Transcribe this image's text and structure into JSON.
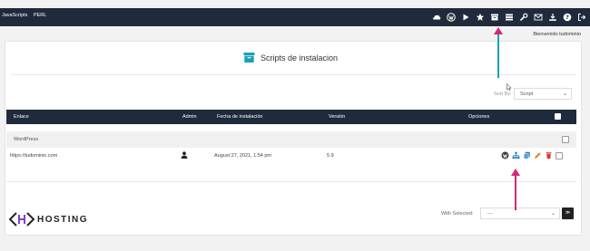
{
  "topbar": {
    "brand_items": [
      "JavaScripts",
      "PERL"
    ],
    "icons": [
      "cloudflare-icon",
      "wordpress-icon",
      "play-icon",
      "star-icon",
      "box-icon",
      "list-icon",
      "wrench-icon",
      "mail-icon",
      "download-icon",
      "help-icon",
      "logout-icon"
    ]
  },
  "welcome_text": "Bienvenido tudominio",
  "page": {
    "title": "Scripts de instalacion",
    "title_icon": "box-icon",
    "sort_label": "Sort By:",
    "sort_value": "Script"
  },
  "table": {
    "columns": [
      "Enlace",
      "Admin",
      "Fecha de instalación",
      "Versión",
      "Opciones"
    ],
    "groups": [
      {
        "name": "WordPress",
        "rows": [
          {
            "link": "https://tudominio.com",
            "admin_icon": "user-icon",
            "date": "August 27, 2021, 1:54 pm",
            "version": "5.9",
            "options": [
              "wordpress-icon",
              "sitemap-icon",
              "clone-icon",
              "edit-icon",
              "trash-icon"
            ]
          }
        ]
      }
    ]
  },
  "footer": {
    "logo_text": "HOSTING",
    "with_selected_label": "With Selected:",
    "with_selected_value": "----",
    "go_label": "≫"
  },
  "colors": {
    "navy": "#1f2b3c",
    "accent_teal": "#1aa0b8",
    "annotation_pink": "#d6257f",
    "wp_blue": "#2b7bb9",
    "edit_orange": "#e8872b",
    "delete_red": "#d9362c"
  }
}
